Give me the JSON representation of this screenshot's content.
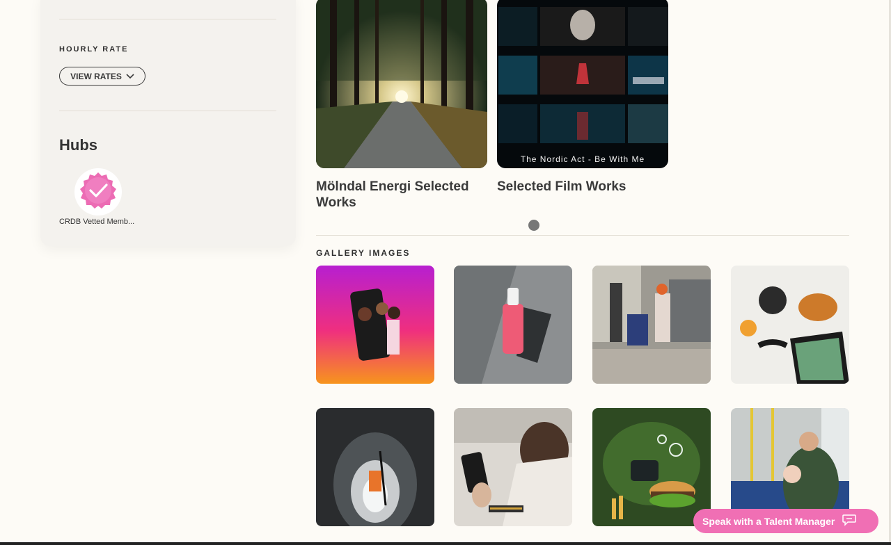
{
  "sidebar": {
    "hourly_rate_label": "HOURLY RATE",
    "view_rates_label": "VIEW RATES",
    "hubs_title": "Hubs",
    "hub_caption": "CRDB Vetted Memb..."
  },
  "projects": [
    {
      "title": "Mölndal Energi Selected Works"
    },
    {
      "title": "Selected Film Works",
      "overlay": "The Nordic Act - Be With Me"
    }
  ],
  "gallery": {
    "label": "GALLERY IMAGES",
    "images": [
      "phone-selfie",
      "pink-spray-bottle",
      "shop-interior",
      "breakfast-table",
      "tunnel-worker",
      "pilot-phone",
      "burger-bubbles",
      "bus-passenger"
    ]
  },
  "cta": {
    "label": "Speak with a Talent Manager"
  },
  "colors": {
    "accent": "#f06fb4",
    "background": "#fdfbf6",
    "card": "#f4f2ee"
  }
}
